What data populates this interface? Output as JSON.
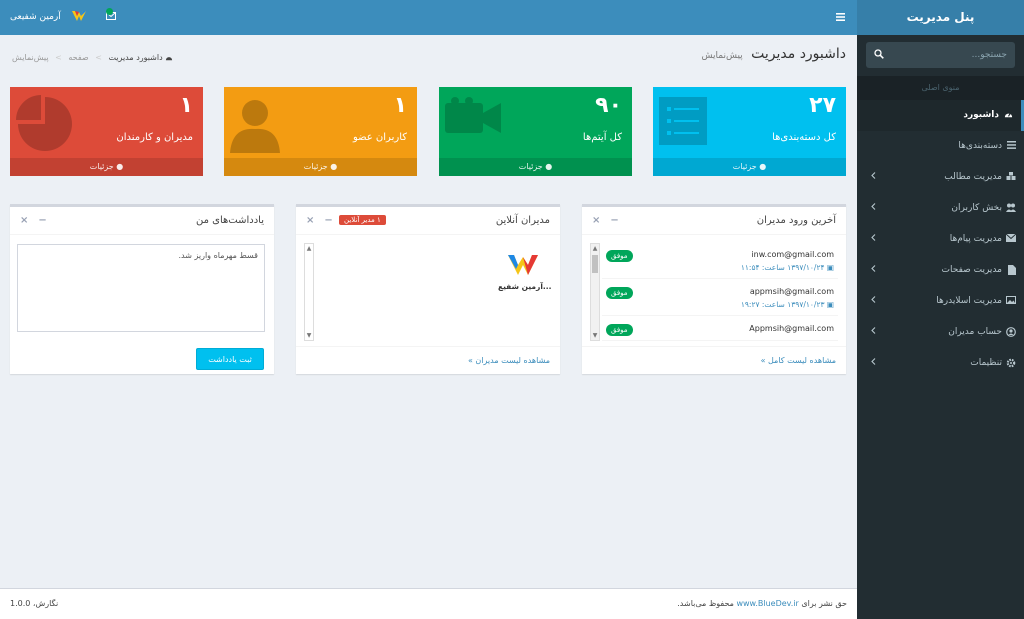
{
  "sidebar": {
    "brand": "پنل مدیریت",
    "search_placeholder": "جستجو...",
    "header": "منوی اصلی",
    "items": [
      {
        "label": "داشبورد",
        "icon": "dashboard-icon"
      },
      {
        "label": "دسته‌بندی‌ها",
        "icon": "list-icon"
      },
      {
        "label": "مدیریت مطالب",
        "icon": "cubes-icon"
      },
      {
        "label": "بخش کاربران",
        "icon": "users-icon"
      },
      {
        "label": "مدیریت پیام‌ها",
        "icon": "envelope-icon"
      },
      {
        "label": "مدیریت صفحات",
        "icon": "file-icon"
      },
      {
        "label": "مدیریت اسلایدرها",
        "icon": "image-icon"
      },
      {
        "label": "حساب مدیران",
        "icon": "user-circle-icon"
      },
      {
        "label": "تنظیمات",
        "icon": "gear-icon"
      }
    ]
  },
  "topbar": {
    "user_name": "آرمین شفیعی"
  },
  "header": {
    "title": "داشبورد مدیریت",
    "subtitle": "پیش‌نمایش"
  },
  "breadcrumb": {
    "home": "داشبورد مدیریت",
    "page": "صفحه",
    "current": "پیش‌نمایش"
  },
  "stats": [
    {
      "number": "۲۷",
      "label": "کل دسته‌بندی‌ها",
      "footer": "جزئیات",
      "color": "#00c0ef"
    },
    {
      "number": "۹۰",
      "label": "کل آیتم‌ها",
      "footer": "جزئیات",
      "color": "#00a65a"
    },
    {
      "number": "۱",
      "label": "کاربران عضو",
      "footer": "جزئیات",
      "color": "#f39c12"
    },
    {
      "number": "۱",
      "label": "مدیران و کارمندان",
      "footer": "جزئیات",
      "color": "#dd4b39"
    }
  ],
  "logins": {
    "title": "آخرین ورود مدیران",
    "items": [
      {
        "email": "inw.com@gmail.com",
        "datetime": "۱۳۹۷/۱۰/۲۴ ساعت: ۱۱:۵۴",
        "status": "موفق"
      },
      {
        "email": "appmsih@gmail.com",
        "datetime": "۱۳۹۷/۱۰/۲۳ ساعت: ۱۹:۲۷",
        "status": "موفق"
      },
      {
        "email": "Appmsih@gmail.com",
        "datetime": "",
        "status": "موفق"
      }
    ],
    "footer": "مشاهده لیست کامل »"
  },
  "online": {
    "title": "مدیران آنلاین",
    "badge": "۱ مدیر آنلاین",
    "user_name": "آرمین شفیع...",
    "footer": "مشاهده لیست مدیران »"
  },
  "notes": {
    "title": "یادداشت‌های من",
    "text": "قسط مهرماه واریز شد.",
    "button": "ثبت یادداشت"
  },
  "footer": {
    "copy_before": "حق نشر برای",
    "copy_link": "www.BlueDev.ir",
    "copy_after": "محفوظ می‌باشد.",
    "version": "نگارش، 1.0.0"
  }
}
